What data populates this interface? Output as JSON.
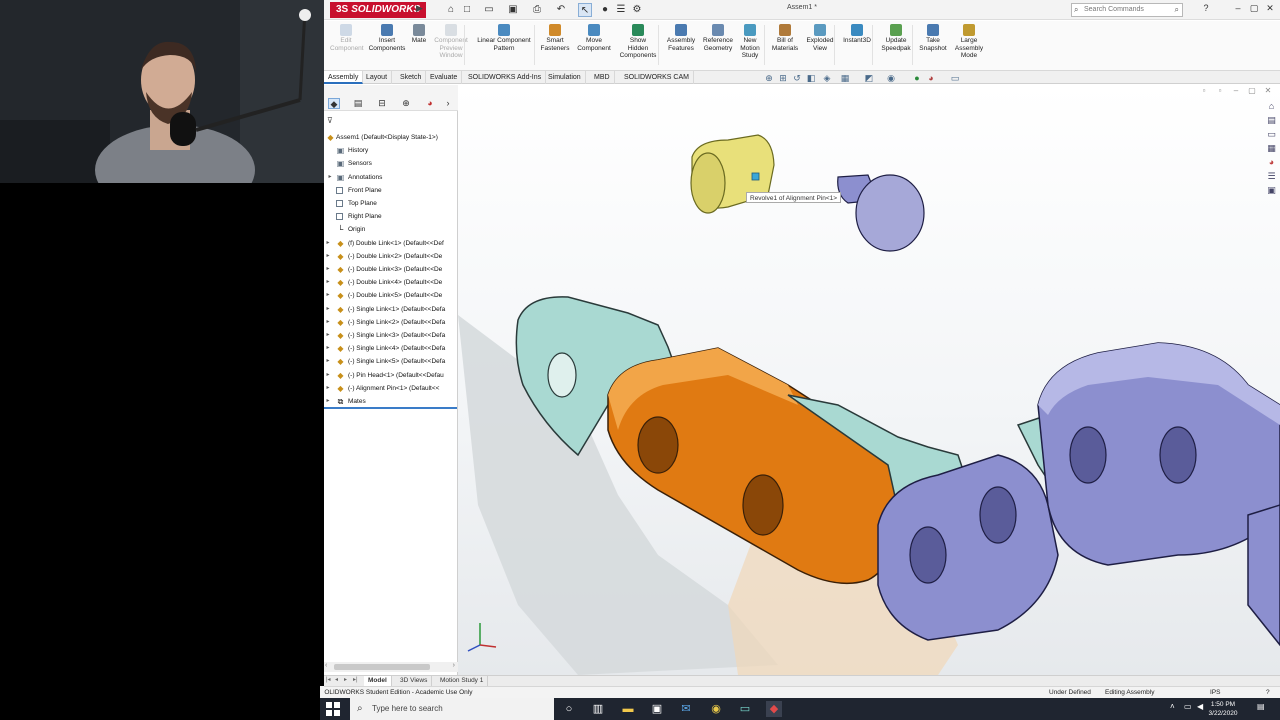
{
  "app": {
    "logo_ds": "3S",
    "logo_text": "SOLIDWORKS",
    "document_title": "Assem1 *",
    "search_placeholder": "Search Commands"
  },
  "commands": [
    {
      "label": "Edit\nComponent",
      "enabled": false
    },
    {
      "label": "Insert\nComponents",
      "enabled": true
    },
    {
      "label": "Mate",
      "enabled": true
    },
    {
      "label": "Component\nPreview\nWindow",
      "enabled": false
    },
    {
      "label": "Linear Component\nPattern",
      "enabled": true
    },
    {
      "label": "Smart\nFasteners",
      "enabled": true
    },
    {
      "label": "Move\nComponent",
      "enabled": true
    },
    {
      "label": "Show\nHidden\nComponents",
      "enabled": true
    },
    {
      "label": "Assembly\nFeatures",
      "enabled": true
    },
    {
      "label": "Reference\nGeometry",
      "enabled": true
    },
    {
      "label": "New\nMotion\nStudy",
      "enabled": true
    },
    {
      "label": "Bill of\nMaterials",
      "enabled": true
    },
    {
      "label": "Exploded\nView",
      "enabled": true
    },
    {
      "label": "Instant3D",
      "enabled": true
    },
    {
      "label": "Update\nSpeedpak",
      "enabled": true
    },
    {
      "label": "Take\nSnapshot",
      "enabled": true
    },
    {
      "label": "Large\nAssembly\nMode",
      "enabled": true
    }
  ],
  "tabs": [
    "Assembly",
    "Layout",
    "Sketch",
    "Evaluate",
    "SOLIDWORKS Add-Ins",
    "Simulation",
    "MBD",
    "SOLIDWORKS CAM"
  ],
  "active_tab": "Assembly",
  "tree": {
    "root": "Assem1  (Default<Display State-1>)",
    "items": [
      {
        "label": "History",
        "kind": "folder",
        "expand": false
      },
      {
        "label": "Sensors",
        "kind": "folder",
        "expand": false
      },
      {
        "label": "Annotations",
        "kind": "folder",
        "expand": true
      },
      {
        "label": "Front Plane",
        "kind": "plane",
        "expand": false
      },
      {
        "label": "Top Plane",
        "kind": "plane",
        "expand": false
      },
      {
        "label": "Right Plane",
        "kind": "plane",
        "expand": false
      },
      {
        "label": "Origin",
        "kind": "origin",
        "expand": false
      },
      {
        "label": "(f) Double Link<1> (Default<<Def",
        "kind": "comp",
        "expand": true
      },
      {
        "label": "(-) Double Link<2> (Default<<De",
        "kind": "comp",
        "expand": true
      },
      {
        "label": "(-) Double Link<3> (Default<<De",
        "kind": "comp",
        "expand": true
      },
      {
        "label": "(-) Double Link<4> (Default<<De",
        "kind": "comp",
        "expand": true
      },
      {
        "label": "(-) Double Link<5> (Default<<De",
        "kind": "comp",
        "expand": true
      },
      {
        "label": "(-) Single Link<1> (Default<<Defa",
        "kind": "comp",
        "expand": true
      },
      {
        "label": "(-) Single Link<2> (Default<<Defa",
        "kind": "comp",
        "expand": true
      },
      {
        "label": "(-) Single Link<3> (Default<<Defa",
        "kind": "comp",
        "expand": true
      },
      {
        "label": "(-) Single Link<4> (Default<<Defa",
        "kind": "comp",
        "expand": true
      },
      {
        "label": "(-) Single Link<5> (Default<<Defa",
        "kind": "comp",
        "expand": true
      },
      {
        "label": "(-) Pin Head<1> (Default<<Defau",
        "kind": "comp",
        "expand": true
      },
      {
        "label": "(-) Alignment Pin<1> (Default<<",
        "kind": "comp",
        "expand": true
      },
      {
        "label": "Mates",
        "kind": "mates",
        "expand": true
      }
    ]
  },
  "graphics": {
    "tooltip": "Revolve1 of Alignment Pin<1>",
    "colors": {
      "orange_link": "#e07a12",
      "teal_link": "#a9d9d2",
      "purple_link": "#8c8fcf",
      "yellow_pin": "#e8e07a",
      "purple_pin": "#a6a8d8"
    }
  },
  "bottom_tabs": [
    "Model",
    "3D Views",
    "Motion Study 1"
  ],
  "active_bottom_tab": "Model",
  "status": {
    "edition": "SOLIDWORKS Student Edition - Academic Use Only",
    "definition": "Under Defined",
    "mode": "Editing Assembly",
    "units": "IPS"
  },
  "taskbar": {
    "search_placeholder": "Type here to search",
    "time": "1:50 PM",
    "date": "3/22/2020"
  }
}
